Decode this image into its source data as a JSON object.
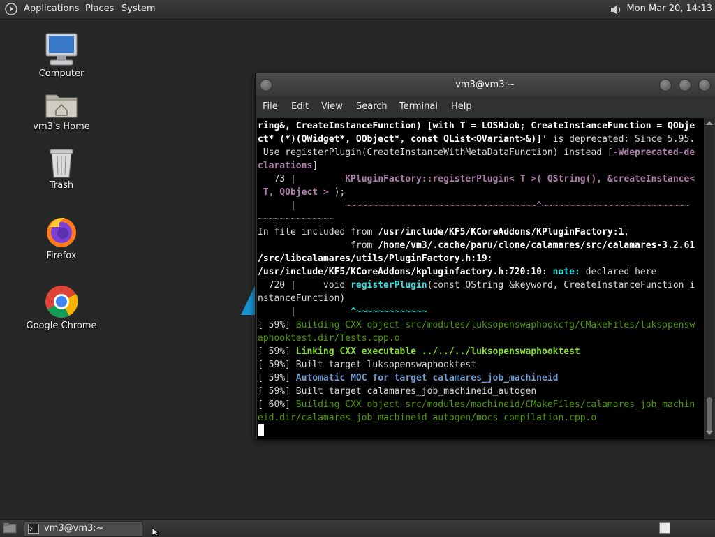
{
  "topbar": {
    "menus": [
      "Applications",
      "Places",
      "System"
    ],
    "clock": "Mon Mar 20, 14:13"
  },
  "desktop": {
    "icons": [
      {
        "label": "Computer",
        "icon": "computer-icon"
      },
      {
        "label": "vm3's Home",
        "icon": "home-folder-icon"
      },
      {
        "label": "Trash",
        "icon": "trash-icon"
      },
      {
        "label": "Firefox",
        "icon": "firefox-icon"
      },
      {
        "label": "Google Chrome",
        "icon": "chrome-icon"
      }
    ]
  },
  "terminal": {
    "title": "vm3@vm3:~",
    "menu": [
      "File",
      "Edit",
      "View",
      "Search",
      "Terminal",
      "Help"
    ],
    "lines": [
      [
        {
          "t": "ring&, CreateInstanceFunction) [with T = LOSHJob; CreateInstanceFunction = QObje",
          "c": "b"
        }
      ],
      [
        {
          "t": "ct* (*)(QWidget*, QObject*, const QList<QVariant>&)]",
          "c": "b"
        },
        {
          "t": "’ is deprecated: Since 5.95.",
          "c": ""
        }
      ],
      [
        {
          "t": " Use registerPlugin(CreateInstanceWithMetaDataFunction) instead [",
          "c": ""
        },
        {
          "t": "-Wdeprecated-de",
          "c": "mgb"
        }
      ],
      [
        {
          "t": "clarations",
          "c": "mgb"
        },
        {
          "t": "]",
          "c": ""
        }
      ],
      [
        {
          "t": "   73 |         ",
          "c": ""
        },
        {
          "t": "KPluginFactory::registerPlugin< T >( QString(), &createInstance<",
          "c": "mgb"
        }
      ],
      [
        {
          "t": " T, QObject > ",
          "c": "mgb"
        },
        {
          "t": ");",
          "c": ""
        }
      ],
      [
        {
          "t": "      |         ",
          "c": ""
        },
        {
          "t": "~~~~~~~~~~~~~~~~~~~~~~~~~~~~~~~~~~~^~~~~~~~~~~~~~~~~~~~~~~~~~~~",
          "c": "mg"
        }
      ],
      [
        {
          "t": "~~~~~~~~~~~~~~",
          "c": "mg"
        }
      ],
      [
        {
          "t": "In file included ",
          "c": ""
        },
        {
          "t": "from ",
          "c": ""
        },
        {
          "t": "/usr/include/KF5/KCoreAddons/KPluginFactory:1",
          "c": "b"
        },
        {
          "t": ",",
          "c": ""
        }
      ],
      [
        {
          "t": "                 from ",
          "c": ""
        },
        {
          "t": "/home/vm3/.cache/paru/clone/calamares/src/calamares-3.2.61",
          "c": "b"
        }
      ],
      [
        {
          "t": "/src/libcalamares/utils/PluginFactory.h:19",
          "c": "b"
        },
        {
          "t": ":",
          "c": ""
        }
      ],
      [
        {
          "t": "/usr/include/KF5/KCoreAddons/kpluginfactory.h:720:10:",
          "c": "b"
        },
        {
          "t": " ",
          "c": ""
        },
        {
          "t": "note:",
          "c": "cyb"
        },
        {
          "t": " declared here",
          "c": ""
        }
      ],
      [
        {
          "t": "  720 |     void ",
          "c": ""
        },
        {
          "t": "registerPlugin",
          "c": "cyb"
        },
        {
          "t": "(const QString &keyword, CreateInstanceFunction i",
          "c": ""
        }
      ],
      [
        {
          "t": "nstanceFunction)",
          "c": ""
        }
      ],
      [
        {
          "t": "      |          ",
          "c": ""
        },
        {
          "t": "^~~~~~~~~~~~~~",
          "c": "cyb"
        }
      ],
      [
        {
          "t": "[ 59%] ",
          "c": ""
        },
        {
          "t": "Building CXX object src/modules/luksopenswaphookcfg/CMakeFiles/luksopensw",
          "c": "gr"
        }
      ],
      [
        {
          "t": "aphooktest.dir/Tests.cpp.o",
          "c": "gr"
        }
      ],
      [
        {
          "t": "[ 59%] ",
          "c": ""
        },
        {
          "t": "Linking CXX executable ../../../luksopenswaphooktest",
          "c": "grb"
        }
      ],
      [
        {
          "t": "[ 59%] Built target luksopenswaphooktest",
          "c": ""
        }
      ],
      [
        {
          "t": "[ 59%] ",
          "c": ""
        },
        {
          "t": "Automatic MOC for target calamares_job_machineid",
          "c": "bl"
        }
      ],
      [
        {
          "t": "[ 59%] Built target calamares_job_machineid_autogen",
          "c": ""
        }
      ],
      [
        {
          "t": "[ 60%] ",
          "c": ""
        },
        {
          "t": "Building CXX object src/modules/machineid/CMakeFiles/calamares_job_machin",
          "c": "gr"
        }
      ],
      [
        {
          "t": "eid.dir/calamares_job_machineid_autogen/mocs_compilation.cpp.o",
          "c": "gr"
        }
      ]
    ]
  },
  "taskbar": {
    "window_label": "vm3@vm3:~"
  },
  "colors": {
    "desktop_bg": "#262828",
    "terminal_bg": "#000000",
    "green": "#4e9a06",
    "bright_green": "#8ae234",
    "magenta": "#ad7fa8",
    "cyan": "#34e2e2",
    "blue": "#729fcf"
  }
}
